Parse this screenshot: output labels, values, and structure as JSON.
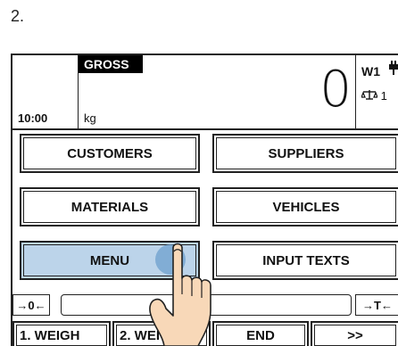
{
  "step_label": "2.",
  "header": {
    "mode_badge": "GROSS",
    "time": "10:00",
    "unit": "kg",
    "weight": "0",
    "scale_id": "W1",
    "scale_number": "1",
    "plug_icon": "plug-icon",
    "balance_icon": "balance-icon"
  },
  "grid": {
    "customers": "CUSTOMERS",
    "suppliers": "SUPPLIERS",
    "materials": "MATERIALS",
    "vehicles": "VEHICLES",
    "menu": "MENU",
    "input_texts": "INPUT TEXTS"
  },
  "bottom": {
    "zero": "→0←",
    "tare": "→T←",
    "weigh1": "1. WEIGH",
    "weigh2": "2. WEI",
    "end": "END",
    "more": ">>"
  },
  "colors": {
    "active_button": "#bcd4ea",
    "touch_indicator": "#6ea0cd",
    "hand_skin": "#f8d8b8"
  }
}
